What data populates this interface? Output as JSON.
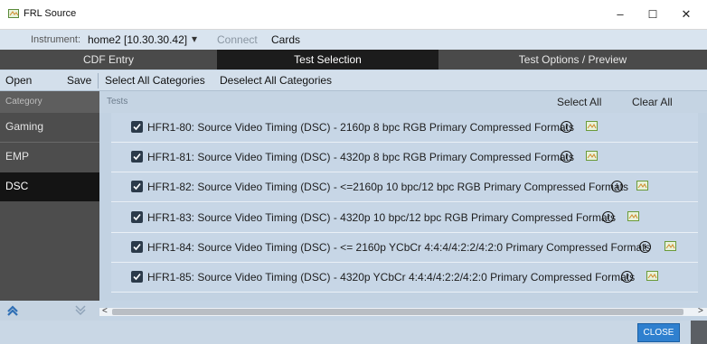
{
  "window": {
    "title": "FRL Source",
    "minimize": "–",
    "maximize": "☐",
    "close": "✕"
  },
  "instrument": {
    "label": "Instrument:",
    "value": "home2 [10.30.30.42]",
    "dropdown": "▾",
    "connect": "Connect",
    "cards": "Cards"
  },
  "tabs": [
    {
      "label": "CDF Entry"
    },
    {
      "label": "Test Selection"
    },
    {
      "label": "Test Options / Preview"
    }
  ],
  "toolbar": {
    "open": "Open",
    "save": "Save",
    "select_all_categories": "Select All Categories",
    "deselect_all_categories": "Deselect All Categories"
  },
  "categories": {
    "header": "Category",
    "items": [
      {
        "label": "Gaming"
      },
      {
        "label": "EMP"
      },
      {
        "label": "DSC"
      }
    ],
    "selected": "DSC"
  },
  "tests": {
    "header": "Tests",
    "select_all": "Select All",
    "clear_all": "Clear All",
    "rows": [
      {
        "label": "HFR1-80: Source Video Timing (DSC) - 2160p 8 bpc RGB Primary Compressed Formats",
        "checked": true
      },
      {
        "label": "HFR1-81: Source Video Timing (DSC) - 4320p 8 bpc RGB Primary Compressed Formats",
        "checked": true
      },
      {
        "label": "HFR1-82: Source Video Timing (DSC) - <=2160p 10 bpc/12 bpc RGB Primary Compressed Formats",
        "checked": true
      },
      {
        "label": "HFR1-83: Source Video Timing (DSC) - 4320p 10 bpc/12 bpc RGB Primary Compressed Formats",
        "checked": true
      },
      {
        "label": "HFR1-84: Source Video Timing (DSC) - <= 2160p YCbCr 4:4:4/4:2:2/4:2:0 Primary Compressed Formats",
        "checked": true
      },
      {
        "label": "HFR1-85: Source Video Timing (DSC) - 4320p YCbCr 4:4:4/4:2:2/4:2:0 Primary Compressed Formats",
        "checked": true
      }
    ]
  },
  "icons": {
    "info": "i",
    "info_icon": "info-icon",
    "document_icon": "document-icon",
    "up": "up-chevrons-icon",
    "down": "down-chevrons-icon"
  },
  "scroll": {
    "left": "<",
    "right": ">"
  },
  "footer": {
    "close_button": "CLOSE"
  },
  "colors": {
    "accent": "#2f80cf",
    "tab_active": "#1c1c1c",
    "category_selected": "#141414"
  }
}
